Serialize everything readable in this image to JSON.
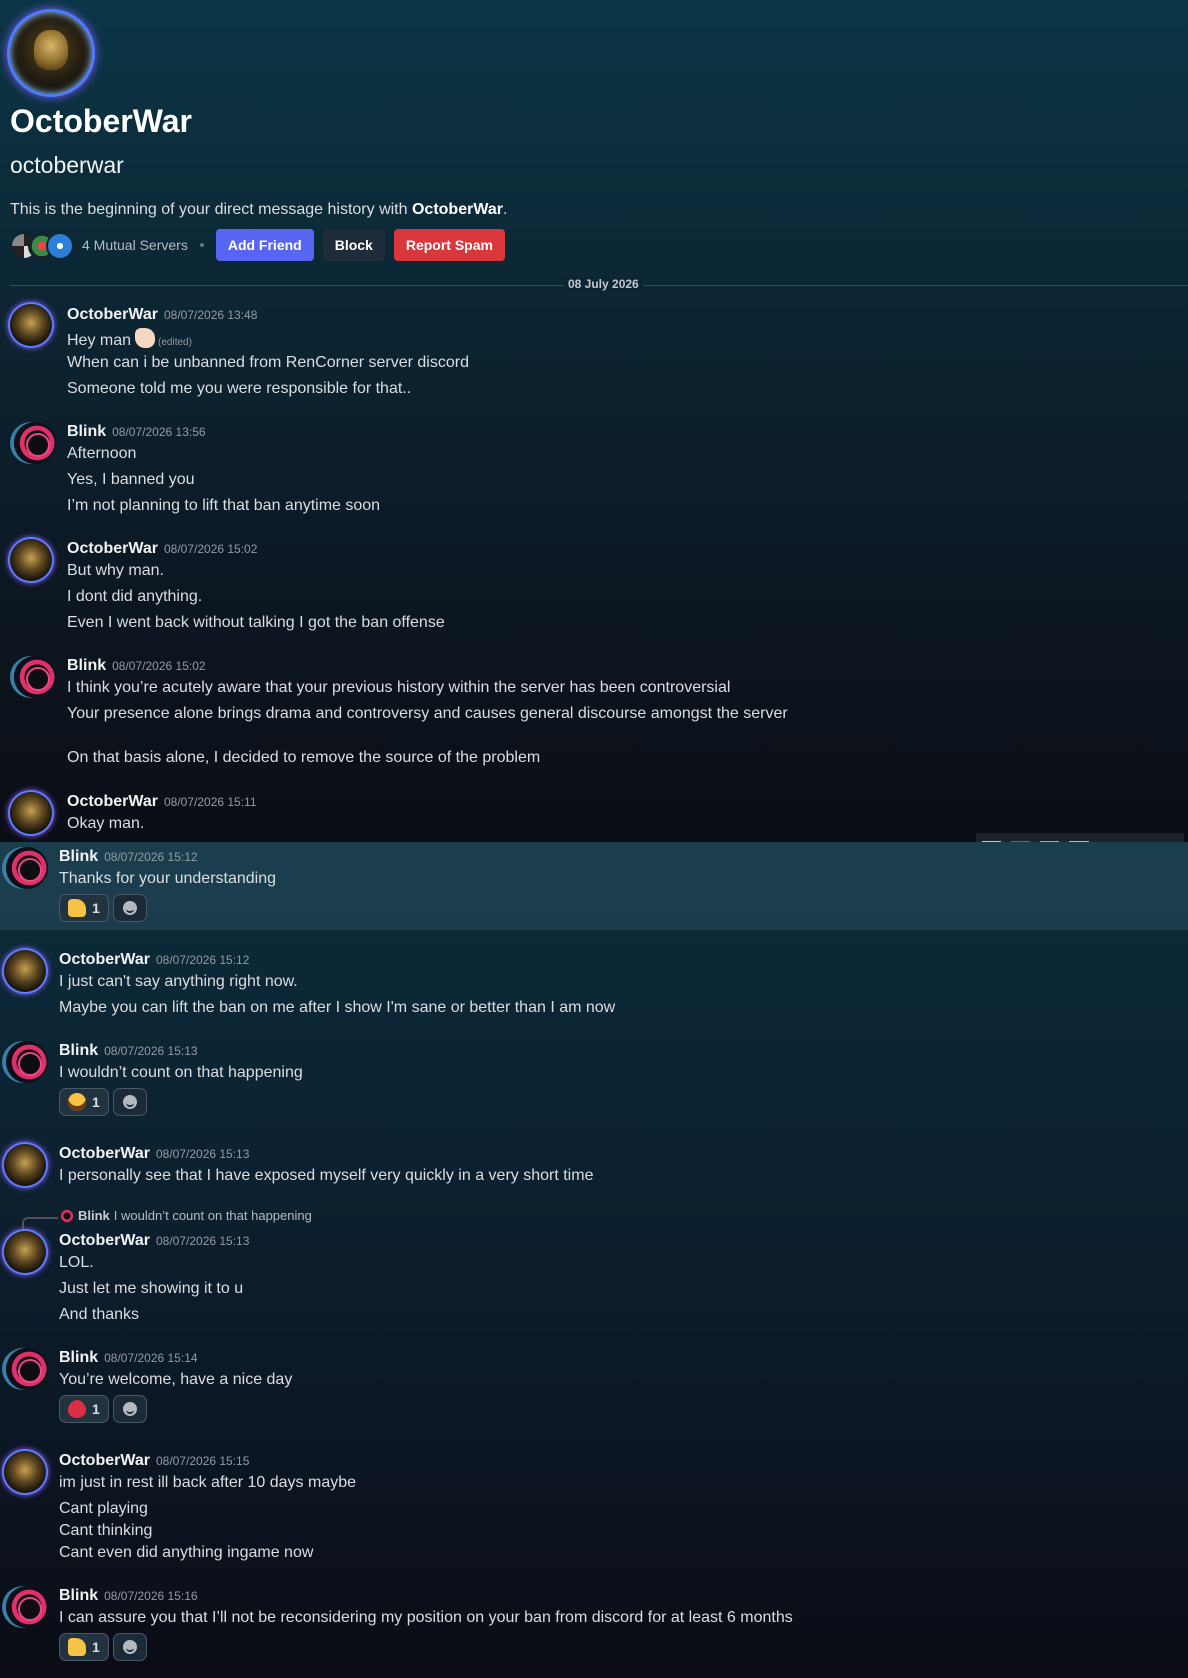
{
  "profile": {
    "display_name": "OctoberWar",
    "username": "octoberwar",
    "intro_prefix": "This is the beginning of your direct message history with ",
    "intro_name": "OctoberWar",
    "intro_suffix": ".",
    "mutual_servers": "4 Mutual Servers",
    "add_friend": "Add Friend",
    "block": "Block",
    "report_spam": "Report Spam"
  },
  "date_divider": "08 July 2026",
  "messages": [
    {
      "author": "OctoberWar",
      "timestamp": "08/07/2026 13:48",
      "lines": [
        "Hey man",
        "When can i be unbanned from RenCorner server discord",
        "Someone told me you were responsible for that.."
      ],
      "edited_label": "(edited)"
    },
    {
      "author": "Blink",
      "timestamp": "08/07/2026 13:56",
      "lines": [
        "Afternoon",
        "Yes, I banned you",
        "I’m not planning to lift that ban anytime soon"
      ]
    },
    {
      "author": "OctoberWar",
      "timestamp": "08/07/2026 15:02",
      "lines": [
        "But why man.",
        "I dont did anything.",
        "Even I went back without talking I got the ban offense"
      ]
    },
    {
      "author": "Blink",
      "timestamp": "08/07/2026 15:02",
      "lines": [
        "I think you’re acutely aware that your previous history within the server has been controversial",
        "Your presence alone brings drama and controversy and causes general discourse amongst the server",
        "On that basis alone, I decided to remove the source of the problem"
      ]
    },
    {
      "author": "OctoberWar",
      "timestamp": "08/07/2026 15:11",
      "lines": [
        "Okay man."
      ]
    },
    {
      "author": "Blink",
      "timestamp": "08/07/2026 15:12",
      "lines": [
        "Thanks for your understanding"
      ],
      "reaction": {
        "emoji": "thumbs-up",
        "count": "1"
      }
    },
    {
      "author": "OctoberWar",
      "timestamp": "08/07/2026 15:12",
      "lines": [
        "I just can't say anything right now.",
        "Maybe you can lift the ban on me after I show I'm sane or better than I am now"
      ]
    },
    {
      "author": "Blink",
      "timestamp": "08/07/2026 15:13",
      "lines": [
        "I wouldn’t count on that happening"
      ],
      "reaction": {
        "emoji": "tears-of-joy",
        "count": "1"
      }
    },
    {
      "author": "OctoberWar",
      "timestamp": "08/07/2026 15:13",
      "lines": [
        "I personally see that I have exposed myself very quickly in a very short time"
      ]
    },
    {
      "author": "OctoberWar",
      "timestamp": "08/07/2026 15:13",
      "lines": [
        "LOL.",
        "Just let me showing it to u",
        "And thanks"
      ],
      "reply": {
        "author": "Blink",
        "text": "I wouldn’t count on that happening"
      }
    },
    {
      "author": "Blink",
      "timestamp": "08/07/2026 15:14",
      "lines": [
        "You’re welcome, have a nice day"
      ],
      "reaction": {
        "emoji": "red-heart",
        "count": "1"
      }
    },
    {
      "author": "OctoberWar",
      "timestamp": "08/07/2026 15:15",
      "lines": [
        "im just in rest ill back after 10 days maybe",
        "Cant playing",
        "Cant thinking",
        "Cant even did anything ingame now"
      ]
    },
    {
      "author": "Blink",
      "timestamp": "08/07/2026 15:16",
      "lines": [
        "I can assure you that I’ll not be reconsidering my position on your ban from discord for at least 6 months"
      ],
      "reaction": {
        "emoji": "thumbs-up",
        "count": "1"
      }
    }
  ],
  "message_toolbar": [
    "tears-of-joy-icon",
    "red-heart-icon",
    "fire-icon",
    "add-reaction-icon",
    "edit-icon",
    "forward-icon",
    "more-icon"
  ],
  "colors": {
    "blurple": "#5865f2",
    "danger": "#da373c",
    "block_button": "#1e2b38"
  }
}
